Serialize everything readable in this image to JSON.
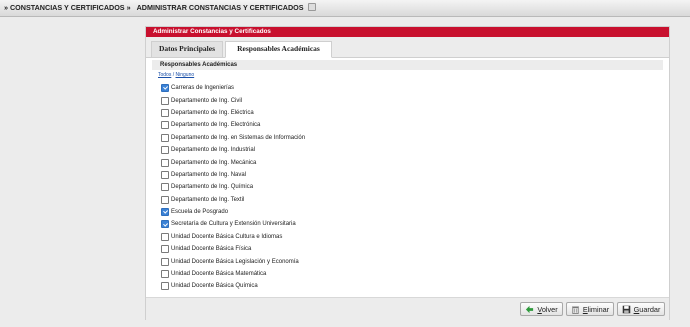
{
  "breadcrumb": {
    "items": [
      "» CONSTANCIAS Y CERTIFICADOS »",
      "ADMINISTRAR CONSTANCIAS Y CERTIFICADOS"
    ]
  },
  "panel": {
    "title": "Administrar Constancias y Certificados",
    "tabs": [
      {
        "label": "Datos Principales",
        "active": false
      },
      {
        "label": "Responsables Académicas",
        "active": true
      }
    ],
    "section_title": "Responsables Académicas",
    "select_links": {
      "all": "Todos",
      "separator": "/",
      "none": "Ninguno"
    },
    "items": [
      {
        "label": "Carreras de Ingenierías",
        "checked": true
      },
      {
        "label": "Departamento de Ing. Civil",
        "checked": false
      },
      {
        "label": "Departamento de Ing. Eléctrica",
        "checked": false
      },
      {
        "label": "Departamento de Ing. Electrónica",
        "checked": false
      },
      {
        "label": "Departamento de Ing. en Sistemas de Información",
        "checked": false
      },
      {
        "label": "Departamento de Ing. Industrial",
        "checked": false
      },
      {
        "label": "Departamento de Ing. Mecánica",
        "checked": false
      },
      {
        "label": "Departamento de Ing. Naval",
        "checked": false
      },
      {
        "label": "Departamento de Ing. Química",
        "checked": false
      },
      {
        "label": "Departamento de Ing. Textil",
        "checked": false
      },
      {
        "label": "Escuela de Posgrado",
        "checked": true
      },
      {
        "label": "Secretaría de Cultura y Extensión Universitaria",
        "checked": true
      },
      {
        "label": "Unidad Docente Básica Cultura e Idiomas",
        "checked": false
      },
      {
        "label": "Unidad Docente Básica Física",
        "checked": false
      },
      {
        "label": "Unidad Docente Básica Legislación y Economía",
        "checked": false
      },
      {
        "label": "Unidad Docente Básica Matemática",
        "checked": false
      },
      {
        "label": "Unidad Docente Básica Química",
        "checked": false
      }
    ]
  },
  "footer": {
    "back_label": "Volver",
    "delete_label": "Eliminar",
    "save_label": "Guardar",
    "back_icon": "back-arrow-icon",
    "delete_icon": "trash-icon",
    "save_icon": "floppy-disk-icon"
  },
  "colors": {
    "header_red": "#c8102e",
    "link_blue": "#1a4fa8",
    "checkbox_blue": "#3b82d6"
  }
}
